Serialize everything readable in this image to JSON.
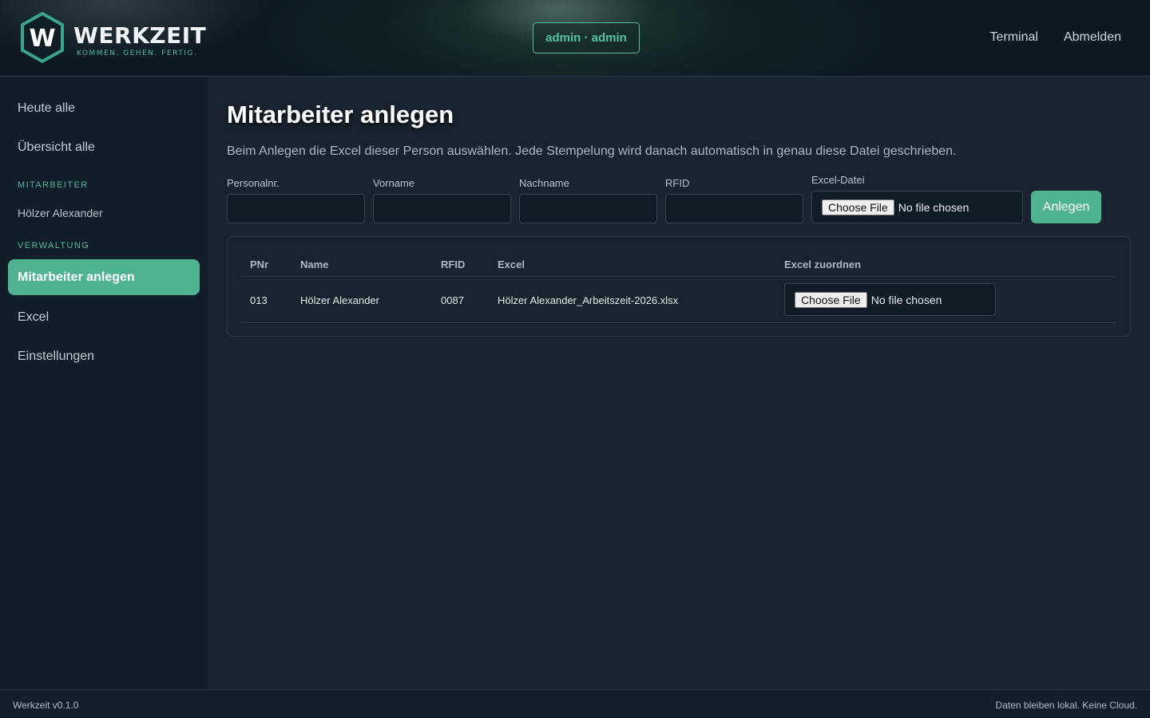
{
  "header": {
    "logo_letter": "W",
    "logo_title": "WERKZEIT",
    "logo_subtitle": "KOMMEN. GEHEN. FERTIG.",
    "user_badge": "admin · admin",
    "nav": {
      "terminal": "Terminal",
      "logout": "Abmelden"
    }
  },
  "sidebar": {
    "today_all": "Heute alle",
    "overview_all": "Übersicht alle",
    "section_employees": "MITARBEITER",
    "employee_1": "Hölzer Alexander",
    "section_admin": "VERWALTUNG",
    "create_employee": "Mitarbeiter anlegen",
    "excel": "Excel",
    "settings": "Einstellungen"
  },
  "main": {
    "title": "Mitarbeiter anlegen",
    "description": "Beim Anlegen die Excel dieser Person auswählen. Jede Stempelung wird danach automatisch in genau diese Datei geschrieben.",
    "form": {
      "personalnr_label": "Personalnr.",
      "personalnr_value": "",
      "vorname_label": "Vorname",
      "vorname_value": "",
      "nachname_label": "Nachname",
      "nachname_value": "",
      "rfid_label": "RFID",
      "rfid_value": "",
      "excel_label": "Excel-Datei",
      "file_button": "Choose File",
      "file_status": "No file chosen",
      "submit": "Anlegen"
    },
    "table": {
      "columns": [
        "PNr",
        "Name",
        "RFID",
        "Excel",
        "Excel zuordnen"
      ],
      "rows": [
        {
          "pnr": "013",
          "name": "Hölzer Alexander",
          "rfid": "0087",
          "excel": "Hölzer Alexander_Arbeitszeit-2026.xlsx",
          "file_button": "Choose File",
          "file_status": "No file chosen"
        }
      ]
    }
  },
  "footer": {
    "version": "Werkzeit v0.1.0",
    "note": "Daten bleiben lokal. Keine Cloud."
  },
  "colors": {
    "accent": "#4fb392",
    "accent_text": "#54c3a1",
    "background": "#19232f",
    "sidebar": "#111d29"
  }
}
